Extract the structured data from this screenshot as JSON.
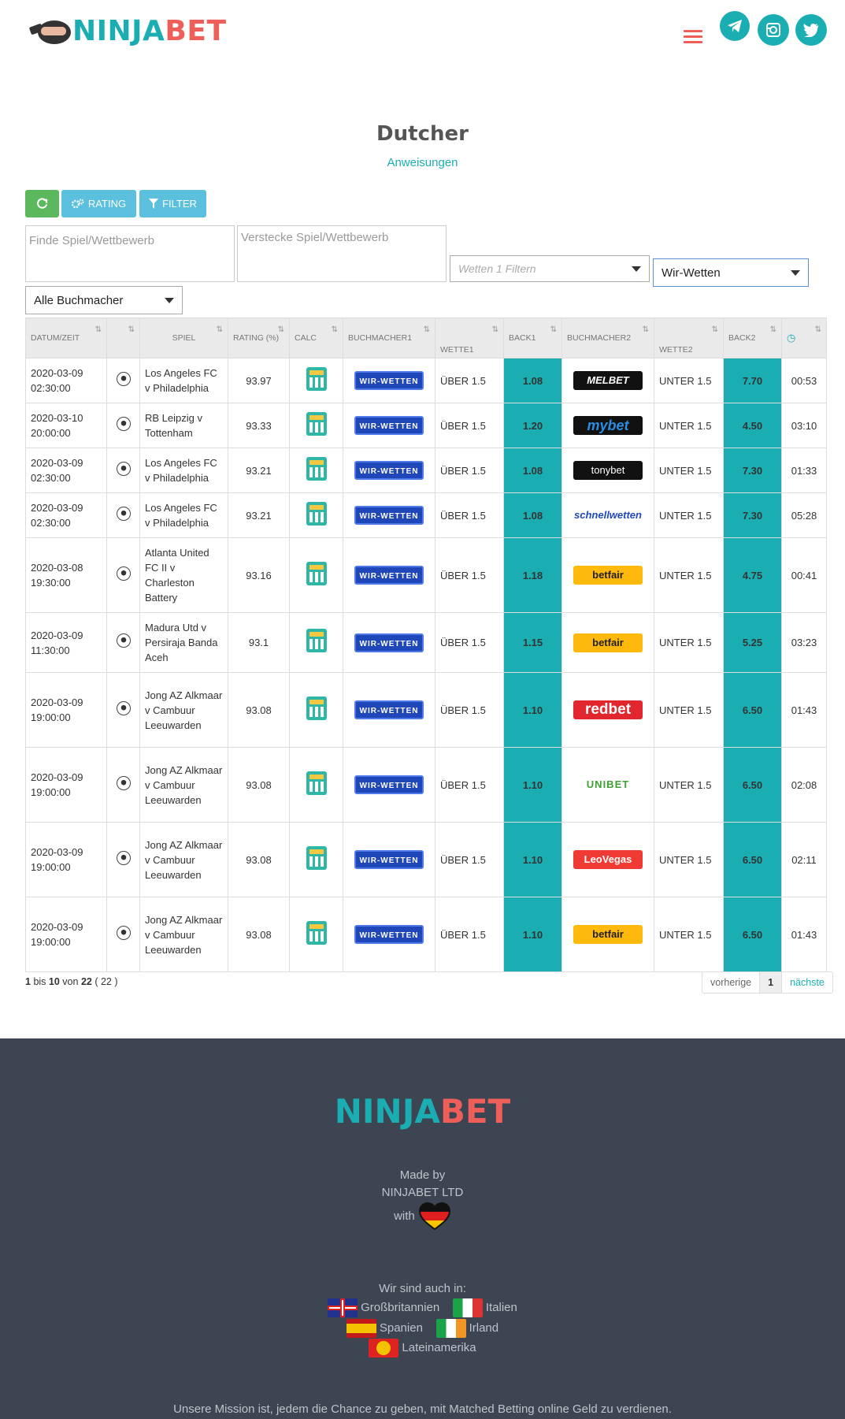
{
  "header": {
    "logo_part1": "NINJA",
    "logo_part2": "BET",
    "menu_icon": "hamburger-icon",
    "social_icons": [
      "telegram-icon",
      "instagram-icon",
      "twitter-icon"
    ]
  },
  "page": {
    "title": "Dutcher",
    "instructions_link": "Anweisungen"
  },
  "toolbar": {
    "refresh_icon": "refresh-icon",
    "rating_label": "RATING",
    "filter_label": "FILTER"
  },
  "filters": {
    "find_placeholder": "Finde Spiel/Wettbewerb",
    "hide_placeholder": "Verstecke Spiel/Wettbewerb",
    "bets_filter_placeholder": "Wetten 1 Filtern",
    "bookmaker2_selected": "Wir-Wetten",
    "all_bookmakers_selected": "Alle Buchmacher"
  },
  "table": {
    "headers": [
      "DATUM/ZEIT",
      "",
      "SPIEL",
      "RATING (%)",
      "CALC",
      "BUCHMACHER1",
      "WETTE1",
      "BACK1",
      "BUCHMACHER2",
      "WETTE2",
      "BACK2",
      ""
    ],
    "rows": [
      {
        "date": "2020-03-09",
        "time": "02:30:00",
        "game": "Los Angeles FC v Philadelphia",
        "rating": "93.97",
        "bookmaker1": "WIR-WETTEN",
        "bet1": "ÜBER 1.5",
        "back1": "1.08",
        "bookmaker2": "MELBET",
        "bk2_style": "melbet",
        "bet2": "UNTER 1.5",
        "back2": "7.70",
        "timer": "00:53"
      },
      {
        "date": "2020-03-10",
        "time": "20:00:00",
        "game": "RB Leipzig v Tottenham",
        "rating": "93.33",
        "bookmaker1": "WIR-WETTEN",
        "bet1": "ÜBER 1.5",
        "back1": "1.20",
        "bookmaker2": "mybet",
        "bk2_style": "mybet",
        "bet2": "UNTER 1.5",
        "back2": "4.50",
        "timer": "03:10"
      },
      {
        "date": "2020-03-09",
        "time": "02:30:00",
        "game": "Los Angeles FC v Philadelphia",
        "rating": "93.21",
        "bookmaker1": "WIR-WETTEN",
        "bet1": "ÜBER 1.5",
        "back1": "1.08",
        "bookmaker2": "tonybet",
        "bk2_style": "tonybet",
        "bet2": "UNTER 1.5",
        "back2": "7.30",
        "timer": "01:33"
      },
      {
        "date": "2020-03-09",
        "time": "02:30:00",
        "game": "Los Angeles FC v Philadelphia",
        "rating": "93.21",
        "bookmaker1": "WIR-WETTEN",
        "bet1": "ÜBER 1.5",
        "back1": "1.08",
        "bookmaker2": "schnellwetten",
        "bk2_style": "schnell",
        "bet2": "UNTER 1.5",
        "back2": "7.30",
        "timer": "05:28"
      },
      {
        "date": "2020-03-08",
        "time": "19:30:00",
        "game": "Atlanta United FC II v Charleston Battery",
        "rating": "93.16",
        "bookmaker1": "WIR-WETTEN",
        "bet1": "ÜBER 1.5",
        "back1": "1.18",
        "bookmaker2": "betfair",
        "bk2_style": "betfair",
        "bet2": "UNTER 1.5",
        "back2": "4.75",
        "timer": "00:41"
      },
      {
        "date": "2020-03-09",
        "time": "11:30:00",
        "game": "Madura Utd v Persiraja Banda Aceh",
        "rating": "93.1",
        "bookmaker1": "WIR-WETTEN",
        "bet1": "ÜBER 1.5",
        "back1": "1.15",
        "bookmaker2": "betfair",
        "bk2_style": "betfair",
        "bet2": "UNTER 1.5",
        "back2": "5.25",
        "timer": "03:23"
      },
      {
        "date": "2020-03-09",
        "time": "19:00:00",
        "game": "Jong AZ Alkmaar v Cambuur Leeuwarden",
        "rating": "93.08",
        "bookmaker1": "WIR-WETTEN",
        "bet1": "ÜBER 1.5",
        "back1": "1.10",
        "bookmaker2": "redbet",
        "bk2_style": "redbet",
        "bet2": "UNTER 1.5",
        "back2": "6.50",
        "timer": "01:43"
      },
      {
        "date": "2020-03-09",
        "time": "19:00:00",
        "game": "Jong AZ Alkmaar v Cambuur Leeuwarden",
        "rating": "93.08",
        "bookmaker1": "WIR-WETTEN",
        "bet1": "ÜBER 1.5",
        "back1": "1.10",
        "bookmaker2": "UNIBET",
        "bk2_style": "unibet",
        "bet2": "UNTER 1.5",
        "back2": "6.50",
        "timer": "02:08"
      },
      {
        "date": "2020-03-09",
        "time": "19:00:00",
        "game": "Jong AZ Alkmaar v Cambuur Leeuwarden",
        "rating": "93.08",
        "bookmaker1": "WIR-WETTEN",
        "bet1": "ÜBER 1.5",
        "back1": "1.10",
        "bookmaker2": "LeoVegas",
        "bk2_style": "leovegas",
        "bet2": "UNTER 1.5",
        "back2": "6.50",
        "timer": "02:11"
      },
      {
        "date": "2020-03-09",
        "time": "19:00:00",
        "game": "Jong AZ Alkmaar v Cambuur Leeuwarden",
        "rating": "93.08",
        "bookmaker1": "WIR-WETTEN",
        "bet1": "ÜBER 1.5",
        "back1": "1.10",
        "bookmaker2": "betfair",
        "bk2_style": "betfair",
        "bet2": "UNTER 1.5",
        "back2": "6.50",
        "timer": "01:43"
      }
    ]
  },
  "pagination": {
    "from": "1",
    "bis": "bis",
    "to": "10",
    "von": "von",
    "total": "22",
    "total_paren": "( 22 )",
    "prev_label": "vorherige",
    "current_page": "1",
    "next_label": "nächste"
  },
  "footer": {
    "logo_part1": "NINJA",
    "logo_part2": "BET",
    "made_by": "Made by",
    "company": "NINJABET LTD",
    "with": "with",
    "also_in": "Wir sind auch in:",
    "countries": [
      {
        "flag": "flag-gb",
        "name": "Großbritannien"
      },
      {
        "flag": "flag-it",
        "name": "Italien"
      },
      {
        "flag": "flag-es",
        "name": "Spanien"
      },
      {
        "flag": "flag-ie",
        "name": "Irland"
      },
      {
        "flag": "flag-la",
        "name": "Lateinamerika"
      }
    ],
    "mission": "Unsere Mission ist, jedem die Chance zu geben, mit Matched Betting online Geld zu verdienen."
  },
  "colors": {
    "brand_teal": "#1aaeb2",
    "brand_red": "#ef5f5a",
    "refresh_green": "#5cb85c",
    "button_blue": "#5bc0de",
    "footer_bg": "#3d4452"
  }
}
